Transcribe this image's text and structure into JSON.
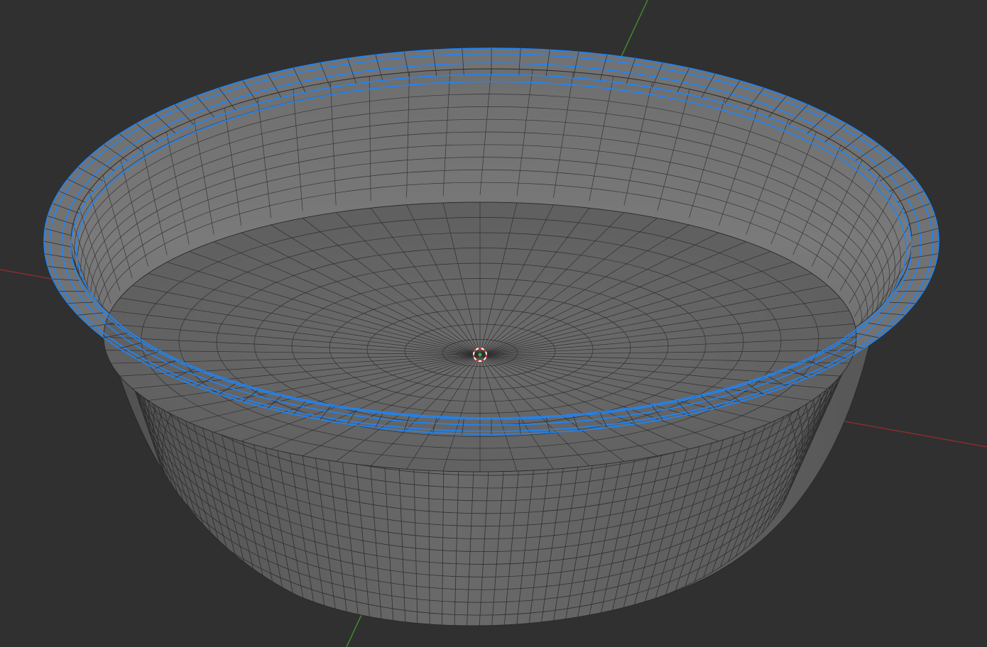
{
  "viewport": {
    "mode": "edit-mode-3d-viewport",
    "object": "bowl-mesh",
    "selection": "rim-edge-loops"
  },
  "colors": {
    "background": "#303030",
    "x_axis": "#8b2c2c",
    "y_axis": "#3f8a2a",
    "mesh_face": "#6a6a6a",
    "mesh_wire": "#2a2a2a",
    "selected_edge": "#1a86ff",
    "cursor_red": "#d03030",
    "cursor_white": "#ffffff"
  },
  "icons": {
    "cursor": "3d-cursor-icon"
  }
}
